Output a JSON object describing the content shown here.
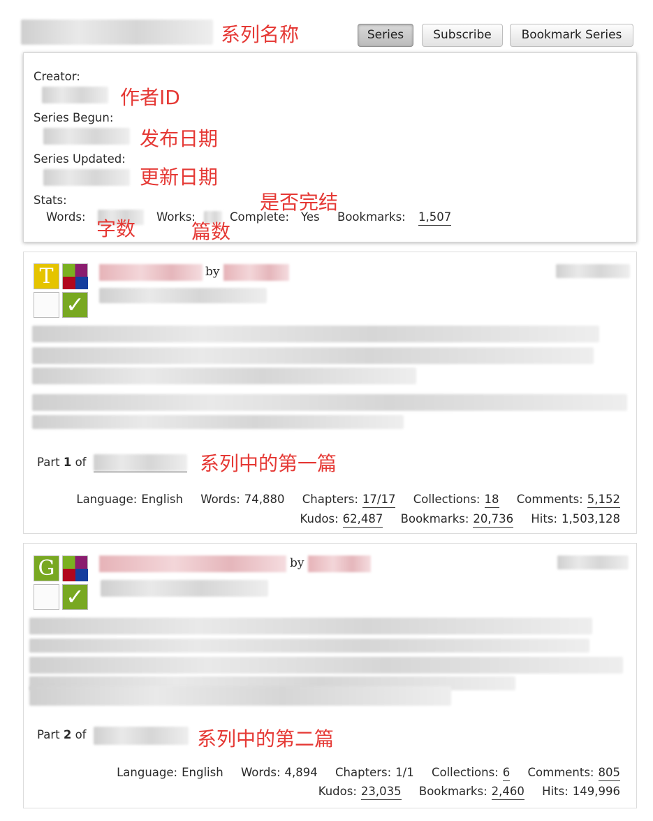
{
  "header": {
    "series_title_annotation": "系列名称",
    "buttons": {
      "series": "Series",
      "subscribe": "Subscribe",
      "bookmark": "Bookmark Series"
    }
  },
  "meta": {
    "creator_label": "Creator:",
    "creator_annotation": "作者ID",
    "begun_label": "Series Begun:",
    "begun_annotation": "发布日期",
    "updated_label": "Series Updated:",
    "updated_annotation": "更新日期",
    "stats_label": "Stats:",
    "words_label": "Words:",
    "words_annotation": "字数",
    "works_label": "Works:",
    "works_annotation": "篇数",
    "complete_label": "Complete:",
    "complete_value": "Yes",
    "complete_annotation": "是否完结",
    "bookmarks_label": "Bookmarks:",
    "bookmarks_value": "1,507"
  },
  "works": [
    {
      "rating_letter": "T",
      "rating_color": "#e5c400",
      "by": "by",
      "part_prefix": "Part",
      "part_number": "1",
      "part_of": "of",
      "part_annotation": "系列中的第一篇",
      "language_label": "Language:",
      "language": "English",
      "words_label": "Words:",
      "words": "74,880",
      "chapters_label": "Chapters:",
      "chapters": "17/17",
      "collections_label": "Collections:",
      "collections": "18",
      "comments_label": "Comments:",
      "comments": "5,152",
      "kudos_label": "Kudos:",
      "kudos": "62,487",
      "bookmarks_label": "Bookmarks:",
      "bookmarks": "20,736",
      "hits_label": "Hits:",
      "hits": "1,503,128"
    },
    {
      "rating_letter": "G",
      "rating_color": "#78a821",
      "by": "by",
      "part_prefix": "Part",
      "part_number": "2",
      "part_of": "of",
      "part_annotation": "系列中的第二篇",
      "language_label": "Language:",
      "language": "English",
      "words_label": "Words:",
      "words": "4,894",
      "chapters_label": "Chapters:",
      "chapters": "1/1",
      "collections_label": "Collections:",
      "collections": "6",
      "comments_label": "Comments:",
      "comments": "805",
      "kudos_label": "Kudos:",
      "kudos": "23,035",
      "bookmarks_label": "Bookmarks:",
      "bookmarks": "2,460",
      "hits_label": "Hits:",
      "hits": "149,996"
    }
  ],
  "icons": {
    "complete": "checkmark-icon",
    "category": "multicolor-category-icon",
    "warning": "blank-warning-icon"
  },
  "colors": {
    "annotation": "#e53935",
    "check_green": "#78a821"
  }
}
